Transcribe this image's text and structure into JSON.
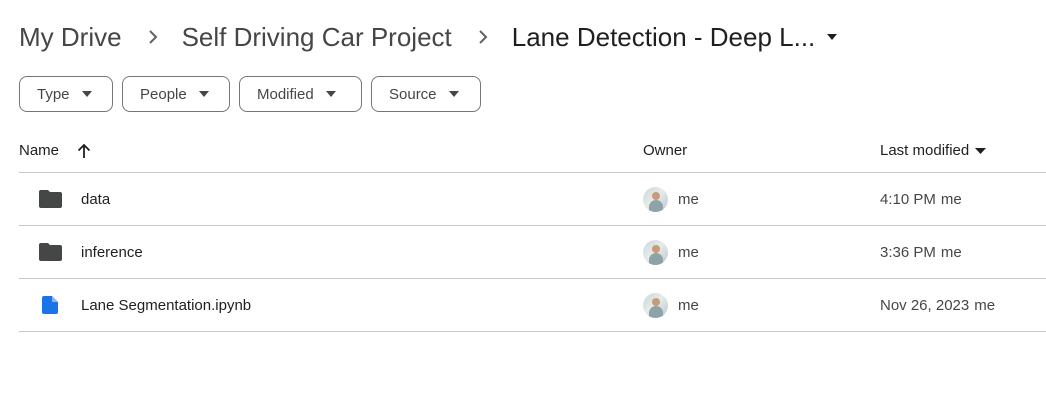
{
  "breadcrumb": {
    "items": [
      "My Drive",
      "Self Driving Car Project"
    ],
    "current": "Lane Detection - Deep L..."
  },
  "filters": [
    "Type",
    "People",
    "Modified",
    "Source"
  ],
  "table": {
    "headers": {
      "name": "Name",
      "owner": "Owner",
      "last_modified": "Last modified"
    },
    "rows": [
      {
        "name": "data",
        "type": "folder-icon",
        "owner": "me",
        "modified": "4:10 PM",
        "modified_by": "me"
      },
      {
        "name": "inference",
        "type": "folder-icon",
        "owner": "me",
        "modified": "3:36 PM",
        "modified_by": "me"
      },
      {
        "name": "Lane Segmentation.ipynb",
        "type": "doc-icon",
        "owner": "me",
        "modified": "Nov 26, 2023",
        "modified_by": "me"
      }
    ]
  },
  "colors": {
    "folder": "#444746",
    "doc": "#1a73e8",
    "divider": "#c7c7c7"
  }
}
